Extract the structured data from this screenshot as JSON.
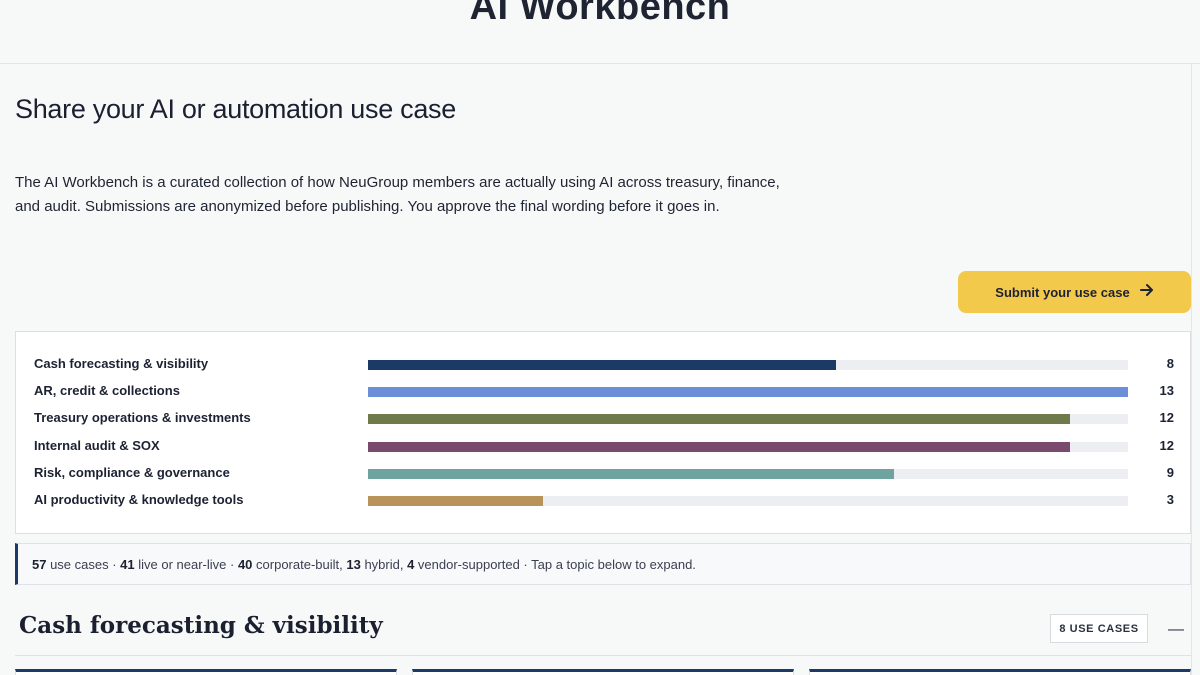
{
  "header": {
    "site_title": "AI Workbench"
  },
  "page": {
    "heading": "Share your AI or automation use case",
    "intro": "The AI Workbench is a curated collection of how NeuGroup members are actually using AI across treasury, finance, and audit. Submissions are anonymized before publishing. You approve the final wording before it goes in.",
    "submit_label": "Submit your use case",
    "submit_icon": "arrow-right-icon"
  },
  "chart_data": {
    "type": "bar",
    "orientation": "horizontal",
    "categories": [
      "Cash forecasting & visibility",
      "AR, credit & collections",
      "Treasury operations & investments",
      "Internal audit & SOX",
      "Risk, compliance & governance",
      "AI productivity & knowledge tools"
    ],
    "values": [
      8,
      13,
      12,
      12,
      9,
      3
    ],
    "value_labels": [
      "8",
      "13",
      "12",
      "12",
      "9",
      "3"
    ],
    "xlim": [
      0,
      13
    ],
    "colors": [
      "#1c3a66",
      "#6b8fd6",
      "#6f7a4a",
      "#7a4a6e",
      "#6fa3a0",
      "#b8935a"
    ],
    "track_color": "#eceef1"
  },
  "stats": {
    "total_count": "57",
    "total_label": " use cases · ",
    "live_count": "41",
    "live_label": " live or near-live · ",
    "corporate_count": "40",
    "corporate_label": " corporate-built, ",
    "hybrid_count": "13",
    "hybrid_label": " hybrid, ",
    "vendor_count": "4",
    "vendor_label": " vendor-supported · Tap a topic below to expand."
  },
  "topic": {
    "title": "Cash forecasting & visibility",
    "count_badge": "8 USE CASES",
    "toggle_symbol": "—",
    "toggle_icon": "collapse-icon"
  }
}
